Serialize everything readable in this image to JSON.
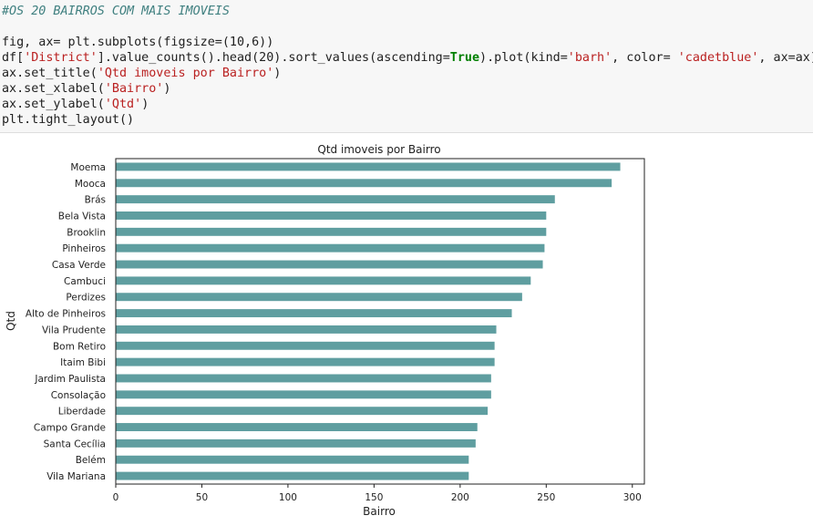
{
  "code": {
    "comment": "#OS 20 BAIRROS COM MAIS IMOVEIS",
    "line_subplots": "fig, ax= plt.subplots(figsize=(10,6))",
    "line_plot": {
      "p1": "df[",
      "s1": "'District'",
      "p2": "].value_counts().head(20).sort_values(ascending=",
      "k1": "True",
      "p3": ").plot(kind=",
      "s2": "'barh'",
      "p4": ", color= ",
      "s3": "'cadetblue'",
      "p5": ", ax=ax)"
    },
    "line_title": {
      "p1": "ax.set_title(",
      "s1": "'Qtd imoveis por Bairro'",
      "p2": ")"
    },
    "line_xlabel": {
      "p1": "ax.set_xlabel(",
      "s1": "'Bairro'",
      "p2": ")"
    },
    "line_ylabel": {
      "p1": "ax.set_ylabel(",
      "s1": "'Qtd'",
      "p2": ")"
    },
    "line_layout": "plt.tight_layout()"
  },
  "chart_data": {
    "type": "bar",
    "orientation": "horizontal",
    "title": "Qtd imoveis por Bairro",
    "xlabel": "Bairro",
    "ylabel": "Qtd",
    "xlim": [
      0,
      307
    ],
    "xticks": [
      0,
      50,
      100,
      150,
      200,
      250,
      300
    ],
    "bar_color": "#5f9ea0",
    "grid": false,
    "categories": [
      "Moema",
      "Mooca",
      "Brás",
      "Bela Vista",
      "Brooklin",
      "Pinheiros",
      "Casa Verde",
      "Cambuci",
      "Perdizes",
      "Alto de Pinheiros",
      "Vila Prudente",
      "Bom Retiro",
      "Itaim Bibi",
      "Jardim Paulista",
      "Consolação",
      "Liberdade",
      "Campo Grande",
      "Santa Cecília",
      "Belém",
      "Vila Mariana"
    ],
    "values": [
      293,
      288,
      255,
      250,
      250,
      249,
      248,
      241,
      236,
      230,
      221,
      220,
      220,
      218,
      218,
      216,
      210,
      209,
      205,
      205
    ]
  }
}
